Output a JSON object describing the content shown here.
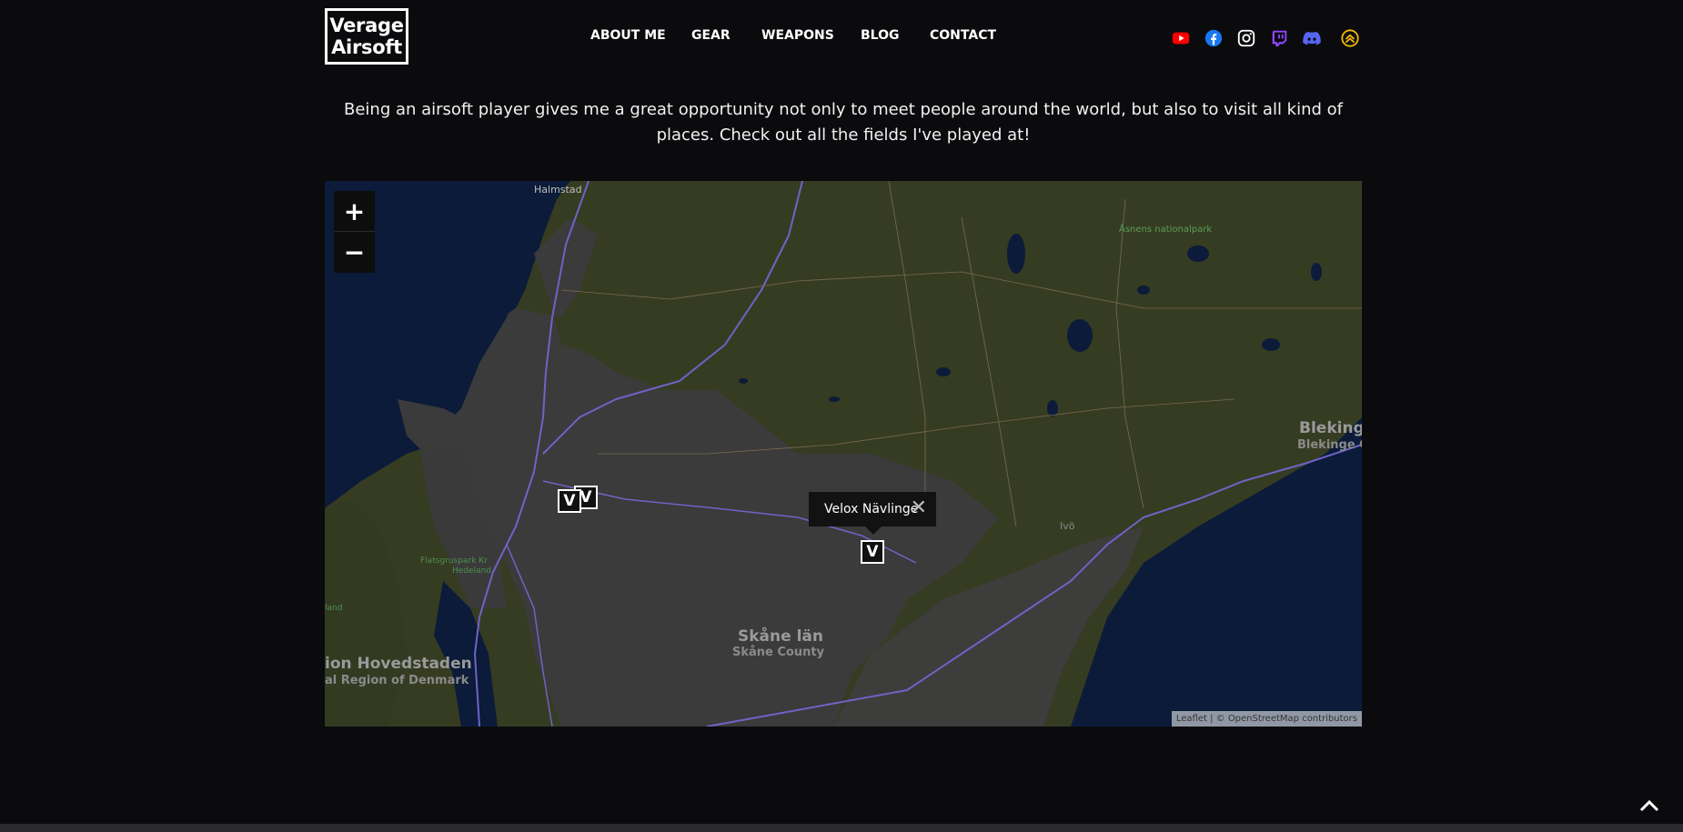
{
  "header": {
    "logo_line1": "Verage",
    "logo_line2": "Airsoft",
    "nav": [
      "ABOUT ME",
      "GEAR",
      "WEAPONS",
      "BLOG",
      "CONTACT"
    ],
    "social": [
      {
        "name": "youtube-icon",
        "color": "#ff0000"
      },
      {
        "name": "facebook-icon",
        "color": "#1877f2"
      },
      {
        "name": "instagram-icon",
        "color": "#ffffff"
      },
      {
        "name": "twitch-icon",
        "color": "#9146ff"
      },
      {
        "name": "discord-icon",
        "color": "#5865f2"
      },
      {
        "name": "airsoft-badge-icon",
        "color": "#f2b705"
      }
    ]
  },
  "intro": "Being an airsoft player gives me a great opportunity not only to meet people around the world, but also to visit all kind of places. Check out all the fields I've played at!",
  "map": {
    "zoom_in": "+",
    "zoom_out": "−",
    "marker_letter": "V",
    "popup_text": "Velox Nävlinge",
    "popup_close": "✕",
    "attribution": "Leaflet | © OpenStreetMap contributors",
    "labels": {
      "halmstad": "Halmstad",
      "asnen": "Åsnens nationalpark",
      "blekinge": "Blekinge",
      "blekinge_county": "Blekinge C",
      "ivo": "Ivö",
      "skane": "Skåne län",
      "skane_county": "Skåne County",
      "hovedstaden": "ion Hovedstaden",
      "denmark": "al Region of Denmark",
      "park": "Flatsgruspark Kr",
      "park2": "Hedeland",
      "land": "land"
    }
  },
  "scroll_top_icon": "chevron-up-icon"
}
